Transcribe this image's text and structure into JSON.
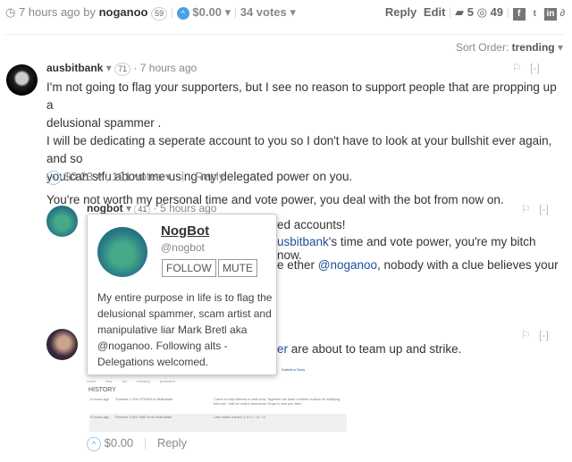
{
  "post_bar": {
    "time": "7 hours ago by",
    "author": "noganoo",
    "rep": "59",
    "payout": "$0.00",
    "votes": "34 votes",
    "reply": "Reply",
    "edit": "Edit",
    "comments": "5",
    "views": "49"
  },
  "sort": {
    "label": "Sort Order:",
    "value": "trending"
  },
  "comments": [
    {
      "author": "ausbitbank",
      "rep": "71",
      "time": "7 hours ago",
      "lines": [
        "I'm not going to flag your supporters, but I see no reason to support people that are propping up a",
        "delusional spammer .",
        "I will be dedicating a seperate account to you so I don't have to look at your bullshit ever again, and so",
        "you can stfu about me using my delegated power on you.",
        "You're not worth my personal time and vote power, you deal with the bot from now on."
      ],
      "payout": "$0.23",
      "votes": "191 votes",
      "reply": "Reply",
      "collapse": "[-]"
    },
    {
      "author": "nogbot",
      "rep": "41",
      "time": "5 hours ago",
      "line1": "ed accounts!",
      "line2_link": "usbitbank",
      "line2_rest": "'s time and vote power, you're my bitch now.",
      "line3_pre": "e ether ",
      "line3_link": "@noganoo",
      "line3_rest": ", nobody with a clue believes your",
      "collapse": "[-]"
    },
    {
      "line1_link": "er",
      "line1_rest": " are about to team up and strike.",
      "payout": "$0.00",
      "reply": "Reply",
      "collapse": "[-]",
      "embed": {
        "nav": [
          "home",
          "new",
          "hot",
          "trending",
          "promoted"
        ],
        "submit": "Submit a Story",
        "history": "HISTORY",
        "rows": [
          [
            "5 hours ago",
            "Transfer 1.000 STEEM to bilalhaider",
            "Come to http://steem.in and chat. Together we have a better chance at nullifying this evil. I will be online tomorrow. Hope to see you then."
          ],
          [
            "5 hours ago",
            "Receive 0.001 SBD from bilalhaider",
            "Lets make a team :) 1+1 = 11 <3"
          ]
        ]
      }
    }
  ],
  "popup": {
    "name": "NogBot",
    "handle": "@nogbot",
    "follow": "FOLLOW",
    "mute": "MUTE",
    "bio_lines": [
      "My entire purpose in life is to flag the",
      "delusional spammer, scam artist and",
      "manipulative liar Mark Bretl aka",
      "@noganoo. Following alts -",
      "Delegations welcomed."
    ]
  },
  "colors": {
    "link": "#1a5099",
    "upvote": "#4aa0e6"
  }
}
